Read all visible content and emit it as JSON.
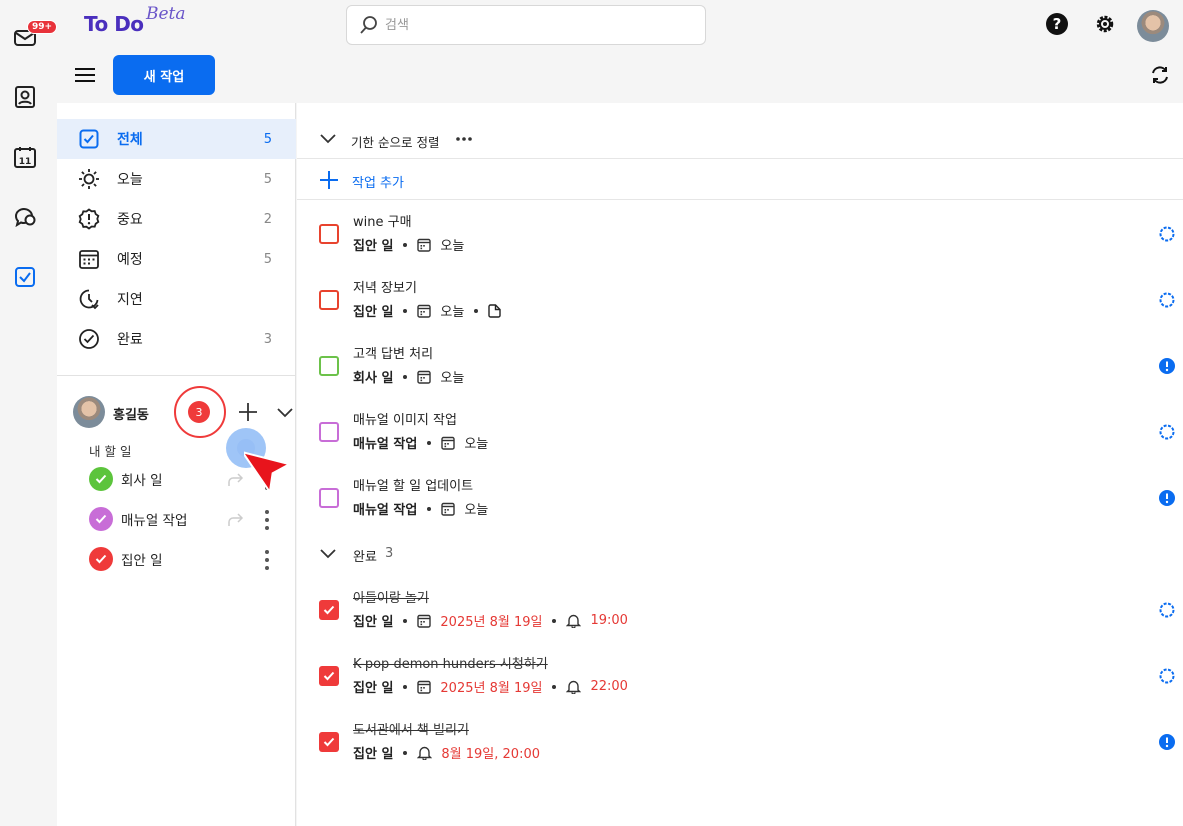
{
  "app": {
    "logo": "To Do",
    "logo_beta": "Beta",
    "mail_badge": "99+",
    "calendar_day": "11",
    "search_placeholder": "검색"
  },
  "toolbar": {
    "new_task_label": "새 작업"
  },
  "sidebar": {
    "nav": [
      {
        "label": "전체",
        "count": "5",
        "icon": "check-square-icon",
        "active": true
      },
      {
        "label": "오늘",
        "count": "5",
        "icon": "sun-icon"
      },
      {
        "label": "중요",
        "count": "2",
        "icon": "alert-badge-icon"
      },
      {
        "label": "예정",
        "count": "5",
        "icon": "calendar-icon"
      },
      {
        "label": "지연",
        "count": "",
        "icon": "clock-late-icon"
      },
      {
        "label": "완료",
        "count": "3",
        "icon": "check-circle-icon"
      }
    ],
    "user": {
      "name": "홍길동",
      "badge": "3"
    },
    "my_lists_title": "내 할 일",
    "lists": [
      {
        "label": "회사 일",
        "color": "#5cc43c"
      },
      {
        "label": "매뉴얼 작업",
        "color": "#c86dd7"
      },
      {
        "label": "집안 일",
        "color": "#ef3a3a"
      }
    ]
  },
  "main": {
    "sort_label": "기한 순으로 정렬",
    "add_task_label": "작업 추가",
    "tasks": [
      {
        "title": "wine 구매",
        "list": "집안 일",
        "date": "오늘",
        "color": "#e8432e",
        "prio": "normal"
      },
      {
        "title": "저녁 장보기",
        "list": "집안 일",
        "date": "오늘",
        "color": "#e8432e",
        "prio": "normal",
        "note": true
      },
      {
        "title": "고객 답변 처리",
        "list": "회사 일",
        "date": "오늘",
        "color": "#6cc24a",
        "prio": "important"
      },
      {
        "title": "매뉴얼 이미지 작업",
        "list": "매뉴얼 작업",
        "date": "오늘",
        "color": "#c86dd7",
        "prio": "normal"
      },
      {
        "title": "매뉴얼 할 일 업데이트",
        "list": "매뉴얼 작업",
        "date": "오늘",
        "color": "#c86dd7",
        "prio": "important"
      }
    ],
    "done_section": {
      "label": "완료",
      "count": "3"
    },
    "done_tasks": [
      {
        "title": "아들이랑 놀기",
        "list": "집안 일",
        "date": "2025년 8월 19일",
        "time": "19:00",
        "prio": "normal"
      },
      {
        "title": "K-pop demon hunders 시청하기",
        "list": "집안 일",
        "date": "2025년 8월 19일",
        "time": "22:00",
        "prio": "normal"
      },
      {
        "title": "도서관에서 책 빌리기",
        "list": "집안 일",
        "reminder": "8월 19일, 20:00",
        "prio": "important"
      }
    ]
  },
  "colors": {
    "accent": "#0a6cf0",
    "danger": "#ef3a3a"
  }
}
